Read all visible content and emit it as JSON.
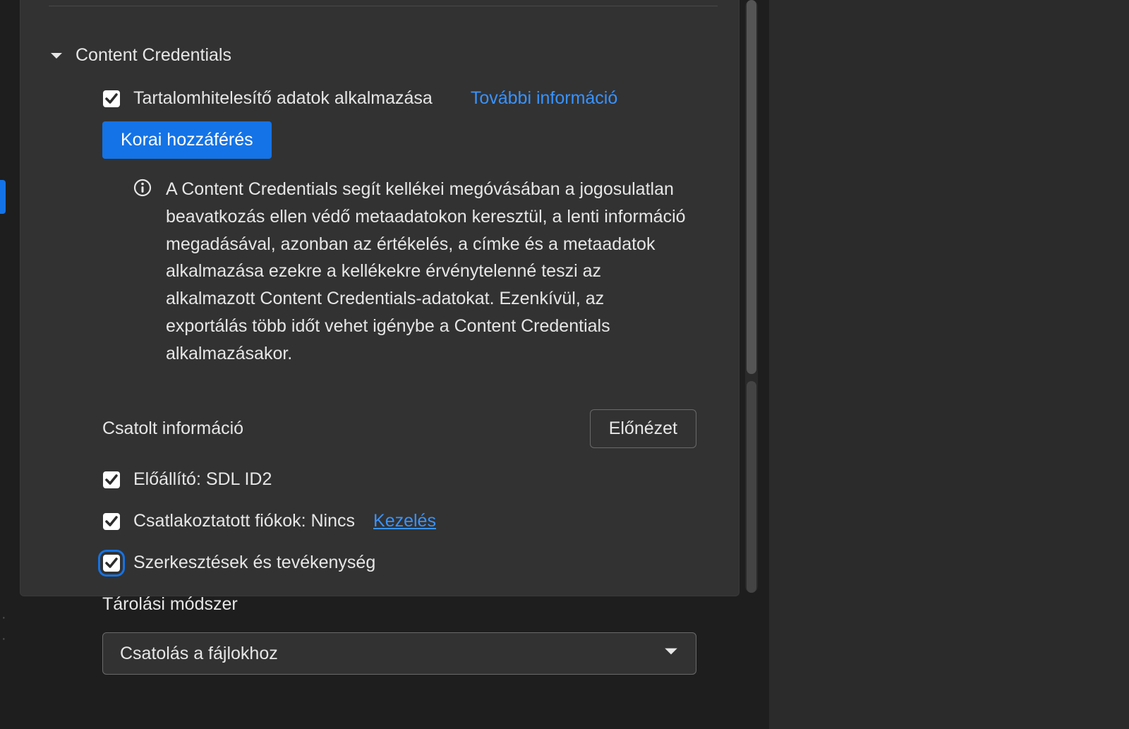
{
  "section": {
    "title": "Content Credentials"
  },
  "apply": {
    "label": "Tartalomhitelesítő adatok alkalmazása",
    "more_info": "További információ",
    "early_access": "Korai hozzáférés"
  },
  "info": {
    "text": "A Content Credentials segít kellékei megóvásában a jogosulatlan beavatkozás ellen védő metaadatokon keresztül, a lenti információ megadásával, azonban az értékelés, a címke és a metaadatok alkalmazása ezekre a kellékekre érvénytelenné teszi az alkalmazott Content Credentials-adatokat. Ezenkívül, az exportálás több időt vehet igénybe a Content Credentials alkalmazásakor."
  },
  "attached": {
    "heading": "Csatolt információ",
    "preview": "Előnézet"
  },
  "items": {
    "producer": "Előállító: SDL ID2",
    "accounts": "Csatlakoztatott fiókok: Nincs",
    "manage": "Kezelés",
    "edits": "Szerkesztések és tevékenység"
  },
  "storage": {
    "label": "Tárolási módszer",
    "selected": "Csatolás a fájlokhoz"
  }
}
